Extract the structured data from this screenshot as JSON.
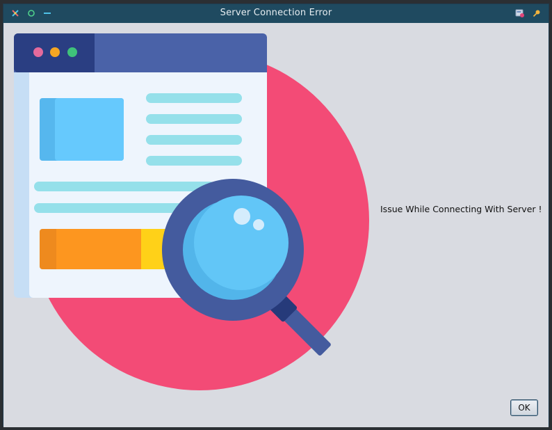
{
  "window": {
    "title": "Server Connection Error"
  },
  "titlebar": {
    "left_icons": [
      "app-menu-icon",
      "maximize-icon",
      "minimize-icon"
    ],
    "right_icons": [
      "window-list-icon",
      "pin-icon"
    ]
  },
  "dialog": {
    "message": "Issue While Connecting With Server !",
    "ok_label": "OK",
    "illustration": "browser-window-with-magnifier-illustration"
  },
  "colors": {
    "titlebar": "#1f4a60",
    "background": "#d9dbe1",
    "circle": "#f34b76",
    "browser_header": "#4a62a8",
    "magnifier_ring": "#445b9e",
    "lens": "#62c6f7"
  }
}
